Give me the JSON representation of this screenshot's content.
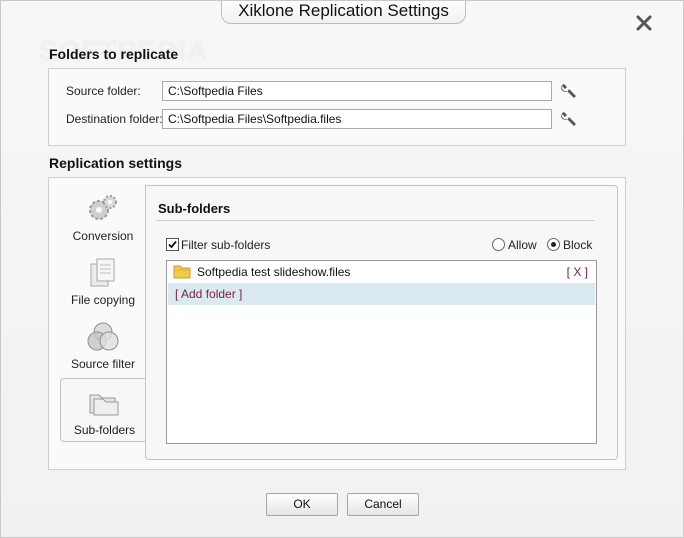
{
  "window": {
    "title": "Xiklone Replication Settings",
    "watermark": "SOFTPEDIA"
  },
  "folders": {
    "section_title": "Folders to replicate",
    "source_label": "Source folder:",
    "source_value": "C:\\Softpedia Files",
    "destination_label": "Destination folder:",
    "destination_value": "C:\\Softpedia Files\\Softpedia.files"
  },
  "replication": {
    "section_title": "Replication settings",
    "sidebar": [
      {
        "label": "Conversion",
        "icon": "gears-icon"
      },
      {
        "label": "File copying",
        "icon": "documents-icon"
      },
      {
        "label": "Source filter",
        "icon": "filter-circles-icon"
      },
      {
        "label": "Sub-folders",
        "icon": "folders-icon",
        "active": true
      }
    ]
  },
  "subfolders": {
    "title": "Sub-folders",
    "filter_label": "Filter sub-folders",
    "filter_checked": true,
    "allow_label": "Allow",
    "block_label": "Block",
    "selected_mode": "Block",
    "items": [
      {
        "name": "Softpedia test slideshow.files",
        "remove_label": "[ X ]"
      }
    ],
    "add_folder_label": "[ Add folder ]"
  },
  "buttons": {
    "ok": "OK",
    "cancel": "Cancel"
  },
  "colors": {
    "link": "#7a1f3d",
    "add_row_bg": "#dbe9f1",
    "folder_icon": "#f2c94c"
  }
}
